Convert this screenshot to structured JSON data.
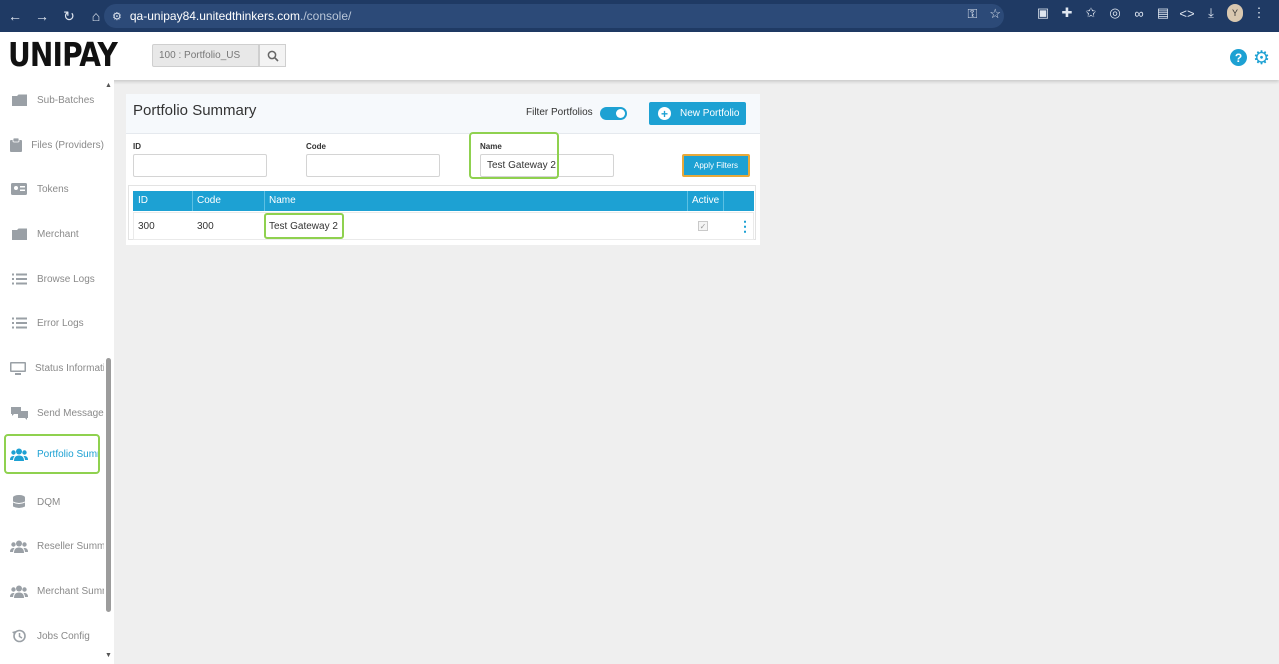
{
  "browser": {
    "url_domain": "qa-unipay84.unitedthinkers.com",
    "url_path": "./console/",
    "avatar_letter": "Y"
  },
  "header": {
    "logo": "UNIPAY",
    "portfolio_selector": "100 : Portfolio_US"
  },
  "sidebar": {
    "items": [
      {
        "label": "Sub-Batches",
        "icon": "folder-icon"
      },
      {
        "label": "Files (Providers)",
        "icon": "clipboard-icon"
      },
      {
        "label": "Tokens",
        "icon": "id-card-icon"
      },
      {
        "label": "Merchant",
        "icon": "folder-icon"
      },
      {
        "label": "Browse Logs",
        "icon": "list-icon"
      },
      {
        "label": "Error Logs",
        "icon": "list-icon"
      },
      {
        "label": "Status Informati",
        "icon": "monitor-icon"
      },
      {
        "label": "Send Message",
        "icon": "chat-icon"
      },
      {
        "label": "Portfolio Summ",
        "icon": "users-icon",
        "active": true
      },
      {
        "label": "DQM",
        "icon": "database-icon"
      },
      {
        "label": "Reseller Summa",
        "icon": "users-icon"
      },
      {
        "label": "Merchant Summ",
        "icon": "users-icon"
      },
      {
        "label": "Jobs Config",
        "icon": "history-icon"
      }
    ]
  },
  "main": {
    "title": "Portfolio Summary",
    "filter_portfolios_label": "Filter Portfolios",
    "filter_portfolios_on": true,
    "new_portfolio_label": "New Portfolio",
    "filters": {
      "id_label": "ID",
      "id_value": "",
      "code_label": "Code",
      "code_value": "",
      "name_label": "Name",
      "name_value": "Test Gateway 2",
      "apply_label": "Apply Filters"
    },
    "table": {
      "columns": [
        "ID",
        "Code",
        "Name",
        "Active"
      ],
      "rows": [
        {
          "id": "300",
          "code": "300",
          "name": "Test Gateway 2",
          "active": true
        }
      ]
    }
  },
  "colors": {
    "accent": "#1da1d3",
    "highlight": "#8fd14f",
    "apply_border": "#e8a93a"
  }
}
